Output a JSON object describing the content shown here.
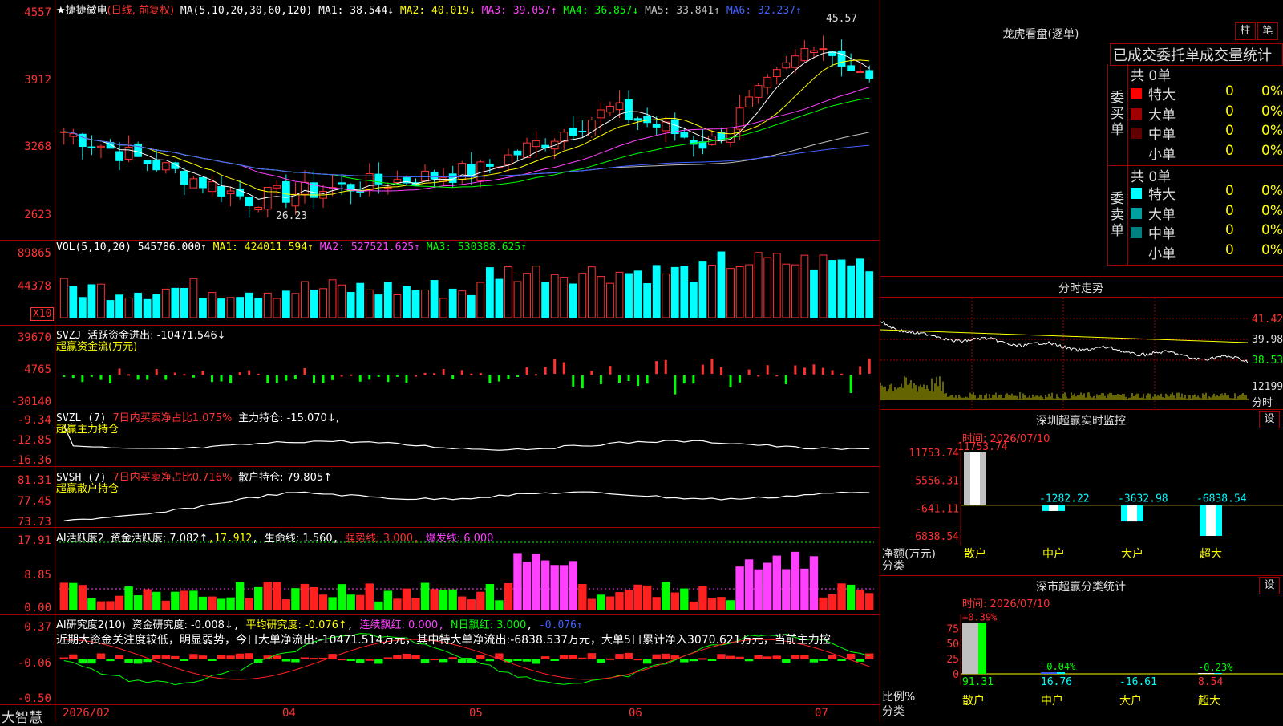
{
  "app": {
    "brand": "大智慧"
  },
  "main": {
    "stock_name": "★捷捷微电",
    "mode": "(日线, 前复权)",
    "ma_label": "MA(5,10,20,30,60,120)",
    "ma1": "MA1: 38.544↓",
    "ma2": "MA2: 40.019↓",
    "ma3": "MA3: 39.057↑",
    "ma4": "MA4: 36.857↓",
    "ma5": "MA5: 33.841↑",
    "ma6": "MA6: 32.237↑",
    "high_mark": "45.57",
    "low_mark": "26.23",
    "y_ticks": [
      "4557",
      "3912",
      "3268",
      "2623"
    ],
    "colors": {
      "up": "#ff3232",
      "down": "#00ffff",
      "ma1": "#ffffff",
      "ma2": "#ffff00",
      "ma3": "#ff40ff",
      "ma4": "#00ff00",
      "ma5": "#c0c0c0",
      "ma6": "#4060ff"
    }
  },
  "vol": {
    "label": "VOL(5,10,20)",
    "value": "545786.000↑",
    "ma1": "MA1: 424011.594↑",
    "ma2": "MA2: 527521.625↑",
    "ma3": "MA3: 530388.625↑",
    "y_ticks": [
      "89865",
      "44378"
    ],
    "unit": "X10"
  },
  "svzj": {
    "label": "SVZJ",
    "name": "活跃资金进出: -10471.546↓",
    "sub": "超赢资金流(万元)",
    "y_ticks": [
      "39670",
      "4765",
      "-30140"
    ]
  },
  "svzl": {
    "label": "SVZL (7)",
    "ratio": "7日内买卖净占比1.075%",
    "hold": "主力持仓: -15.070↓,",
    "sub": "超赢主力持仓",
    "y_ticks": [
      "-9.34",
      "-12.85",
      "-16.36"
    ]
  },
  "svsh": {
    "label": "SVSH (7)",
    "ratio": "7日内买卖净占比0.716%",
    "hold": "散户持仓: 79.805↑",
    "sub": "超赢散户持仓",
    "y_ticks": [
      "81.31",
      "77.45",
      "73.73"
    ]
  },
  "ai1": {
    "label": "AI活跃度2",
    "a": "资金活跃度: 7.082↑",
    "b": "17.912",
    "c": "生命线: 1.560",
    "d": "强势线: 3.000",
    "e": "爆发线: 6.000",
    "y_ticks": [
      "17.91",
      "8.85",
      "0.00"
    ]
  },
  "ai2": {
    "label": "AI研究度2(10)",
    "a": "资金研究度: -0.008↓",
    "b": "平均研究度: -0.076↑",
    "c": "连续飘红: 0.000",
    "d": "N日飘红: 3.000",
    "e": "-0.076↑",
    "note": "近期大资金关注度较低，明显弱势，今日大单净流出:-10471.514万元，其中特大单净流出:-6838.537万元，大单5日累计净入3070.621万元，当前主力控",
    "y_ticks": [
      "0.37",
      "-0.06",
      "-0.50"
    ]
  },
  "x_axis": [
    "2026/02",
    "04",
    "05",
    "06",
    "07"
  ],
  "lhb": {
    "title": "龙虎看盘(逐单)",
    "btn1": "柱",
    "btn2": "笔",
    "subtitle": "已成交委托单成交量统计",
    "buy_label": "委买单",
    "sell_label": "委卖单",
    "buy_total": "共 0单",
    "sell_total": "共 0单",
    "buy_rows": [
      {
        "name": "特大",
        "count": "0",
        "pct": "0%",
        "color": "#ff0000"
      },
      {
        "name": "大单",
        "count": "0",
        "pct": "0%",
        "color": "#a00000"
      },
      {
        "name": "中单",
        "count": "0",
        "pct": "0%",
        "color": "#600000"
      },
      {
        "name": "小单",
        "count": "0",
        "pct": "0%",
        "color": "#000000"
      }
    ],
    "sell_rows": [
      {
        "name": "特大",
        "count": "0",
        "pct": "0%",
        "color": "#00ffff"
      },
      {
        "name": "大单",
        "count": "0",
        "pct": "0%",
        "color": "#00a0a0"
      },
      {
        "name": "中单",
        "count": "0",
        "pct": "0%",
        "color": "#008080"
      },
      {
        "name": "小单",
        "count": "0",
        "pct": "0%",
        "color": "#000000"
      }
    ]
  },
  "intraday": {
    "title": "分时走势",
    "y_ticks": [
      "41.42",
      "39.98",
      "38.53"
    ],
    "vol_tick": "12199",
    "bottom": "分时"
  },
  "sz_monitor": {
    "title": "深圳超赢实时监控",
    "btn": "设",
    "time": "时间: 2026/07/10",
    "y_ticks": [
      "11753.74",
      "5556.31",
      "-641.11",
      "-6838.54"
    ],
    "unit": "净额(万元)",
    "cat_label": "分类",
    "categories": [
      "散户",
      "中户",
      "大户",
      "超大"
    ],
    "values": [
      11753.74,
      -1282.22,
      -3632.98,
      -6838.54
    ],
    "value_labels": [
      "11753.74",
      "-1282.22",
      "-3632.98",
      "-6838.54"
    ]
  },
  "sz_class": {
    "title": "深市超赢分类统计",
    "btn": "设",
    "time": "时间: 2026/07/10",
    "y_ticks": [
      "75",
      "50",
      "25",
      "0"
    ],
    "unit": "比例%",
    "cat_label": "分类",
    "categories": [
      "散户",
      "中户",
      "大户",
      "超大"
    ],
    "change_labels": [
      "+0.39%",
      "-0.04%",
      "",
      "-0.23%"
    ],
    "values": [
      91.31,
      16.76,
      -16.61,
      8.54
    ],
    "value_labels": [
      "91.31",
      "16.76",
      "-16.61",
      "8.54"
    ]
  }
}
